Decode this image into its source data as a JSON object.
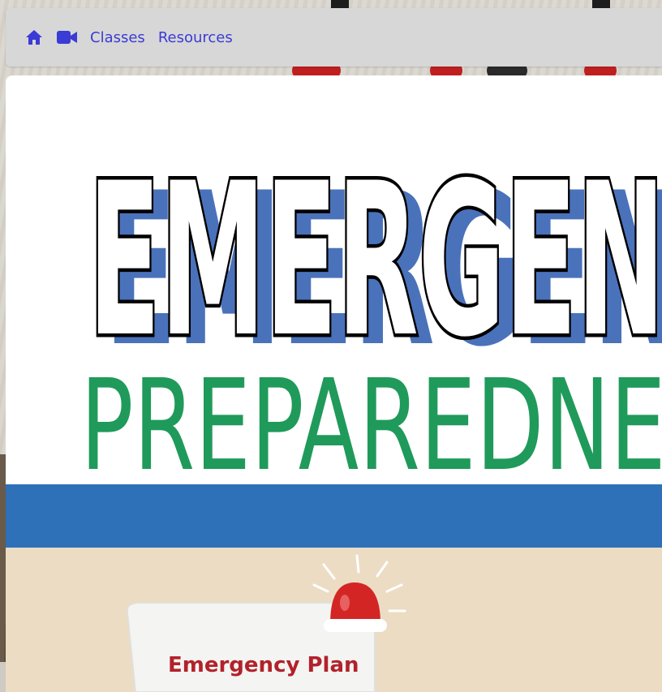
{
  "nav": {
    "links": [
      "Classes",
      "Resources"
    ],
    "link_color": "#3b3bd6",
    "icons": [
      "home-icon",
      "video-camera-icon"
    ]
  },
  "poster": {
    "headline": "EMERGENCY",
    "subheadline": "PREPAREDNESS",
    "card_label": "Emergency Plan",
    "colors": {
      "headline_shadow": "#4a72bb",
      "subheadline": "#1f9a5a",
      "band": "#2e71b8",
      "lower_bg": "#ecdcc4",
      "siren": "#d42525"
    }
  }
}
